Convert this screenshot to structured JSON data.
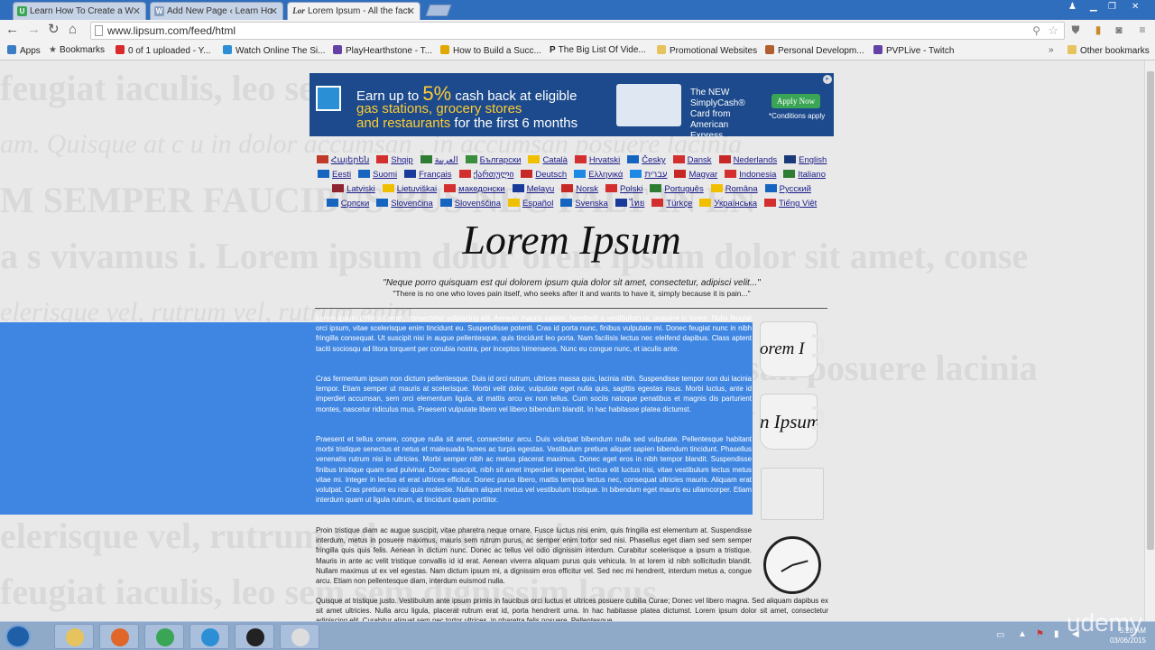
{
  "tabs": [
    {
      "title": "Learn How To Create a W",
      "favicon": "U",
      "color": "#3aa655"
    },
    {
      "title": "Add New Page ‹ Learn Ho",
      "favicon": "W",
      "color": "#8aa0bf"
    },
    {
      "title": "Lorem Ipsum - All the fact",
      "favicon": "Lor",
      "color": "#555555",
      "active": true
    }
  ],
  "toolbar": {
    "url": "www.lipsum.com/feed/html"
  },
  "bookmarks": [
    {
      "label": "Apps",
      "color": "#3c7ec6"
    },
    {
      "label": "Bookmarks",
      "color": "#555555"
    },
    {
      "label": "0 of 1 uploaded - Y...",
      "color": "#d92b2b"
    },
    {
      "label": "Watch Online The Si...",
      "color": "#2c8fd6"
    },
    {
      "label": "PlayHearthstone - T...",
      "color": "#6441a5"
    },
    {
      "label": "How to Build a Succ...",
      "color": "#e0a800"
    },
    {
      "label": "The Big List Of Vide...",
      "color": "#222222"
    },
    {
      "label": "Promotional Websites",
      "color": "#e6c35c"
    },
    {
      "label": "Personal Developm...",
      "color": "#b06030"
    },
    {
      "label": "PVPLive - Twitch",
      "color": "#6441a5"
    },
    {
      "label": "Other bookmarks",
      "color": "#e6c35c"
    }
  ],
  "ad": {
    "line1_pre": "Earn up to ",
    "line1_pct": "5%",
    "line1_post": " cash back at eligible",
    "line2": "gas stations, grocery stores",
    "line3_a": "and restaurants",
    "line3_b": " for the first 6 months",
    "card_text": "The NEW SimplyCash® Card from American Express",
    "apply": "Apply Now",
    "conditions": "*Conditions apply"
  },
  "languages": [
    {
      "name": "Հայերեն",
      "color": "#c0392b"
    },
    {
      "name": "Shqip",
      "color": "#d32f2f"
    },
    {
      "name": "‏العربية",
      "color": "#2e7d32"
    },
    {
      "name": "Български",
      "color": "#388e3c"
    },
    {
      "name": "Català",
      "color": "#f0c000"
    },
    {
      "name": "Hrvatski",
      "color": "#d32f2f"
    },
    {
      "name": "Česky",
      "color": "#1565c0"
    },
    {
      "name": "Dansk",
      "color": "#d32f2f"
    },
    {
      "name": "Nederlands",
      "color": "#c62828"
    },
    {
      "name": "English",
      "color": "#1a3a7a"
    },
    {
      "name": "Eesti",
      "color": "#1565c0"
    },
    {
      "name": "Suomi",
      "color": "#1565c0"
    },
    {
      "name": "Français",
      "color": "#1a3a9a"
    },
    {
      "name": "ქართული",
      "color": "#d32f2f"
    },
    {
      "name": "Deutsch",
      "color": "#c62828"
    },
    {
      "name": "Ελληνικά",
      "color": "#1e88e5"
    },
    {
      "name": "עברית",
      "color": "#1e88e5"
    },
    {
      "name": "Magyar",
      "color": "#c62828"
    },
    {
      "name": "Indonesia",
      "color": "#d32f2f"
    },
    {
      "name": "Italiano",
      "color": "#2e7d32"
    },
    {
      "name": "Latviski",
      "color": "#8e2430"
    },
    {
      "name": "Lietuviškai",
      "color": "#f0c000"
    },
    {
      "name": "македонски",
      "color": "#d32f2f"
    },
    {
      "name": "Melayu",
      "color": "#1a3a9a"
    },
    {
      "name": "Norsk",
      "color": "#c62828"
    },
    {
      "name": "Polski",
      "color": "#d32f2f"
    },
    {
      "name": "Português",
      "color": "#2e7d32"
    },
    {
      "name": "Româna",
      "color": "#f0c000"
    },
    {
      "name": "Pусский",
      "color": "#1565c0"
    },
    {
      "name": "Српски",
      "color": "#1565c0"
    },
    {
      "name": "Slovenčina",
      "color": "#1565c0"
    },
    {
      "name": "Slovenščina",
      "color": "#1565c0"
    },
    {
      "name": "Español",
      "color": "#f0c000"
    },
    {
      "name": "Svenska",
      "color": "#1565c0"
    },
    {
      "name": "ไทย",
      "color": "#1a3a9a"
    },
    {
      "name": "Türkçe",
      "color": "#d32f2f"
    },
    {
      "name": "Українська",
      "color": "#f0c000"
    },
    {
      "name": "Tiếng Việt",
      "color": "#d32f2f"
    }
  ],
  "main": {
    "title": "Lorem Ipsum",
    "quote_latin": "\"Neque porro quisquam est qui dolorem ipsum quia dolor sit amet, consectetur, adipisci velit...\"",
    "quote_english": "\"There is no one who loves pain itself, who seeks after it and wants to have it, simply because it is pain...\"",
    "paragraphs": [
      "Lorem ipsum dolor sit amet, consectetur adipiscing elit. Aenean mauris sapien, hendrerit a vestibulum ut, posuere in lorem. Nulla feugiat orci ipsum, vitae scelerisque enim tincidunt eu. Suspendisse potenti. Cras id porta nunc, finibus vulputate mi. Donec feugiat nunc in nibh fringilla consequat. Ut suscipit nisi in augue pellentesque, quis tincidunt leo porta. Nam facilisis lectus nec eleifend dapibus. Class aptent taciti sociosqu ad litora torquent per conubia nostra, per inceptos himenaeos. Nunc eu congue nunc, et iaculis ante.",
      "Cras fermentum ipsum non dictum pellentesque. Duis id orci rutrum, ultrices massa quis, lacinia nibh. Suspendisse tempor non dui lacinia tempor. Etiam semper ut mauris at scelerisque. Morbi velit dolor, vulputate eget nulla quis, sagittis egestas risus. Morbi luctus, ante id imperdiet accumsan, sem orci elementum ligula, at mattis arcu ex non tellus. Cum sociis natoque penatibus et magnis dis parturient montes, nascetur ridiculus mus. Praesent vulputate libero vel libero bibendum blandit. In hac habitasse platea dictumst.",
      "Praesent et tellus ornare, congue nulla sit amet, consectetur arcu. Duis volutpat bibendum nulla sed vulputate. Pellentesque habitant morbi tristique senectus et netus et malesuada fames ac turpis egestas. Vestibulum pretium aliquet sapien bibendum tincidunt. Phasellus venenatis rutrum nisi in ultricies. Morbi semper nibh ac metus placerat maximus. Donec eget eros in nibh tempor blandit. Suspendisse finibus tristique quam sed pulvinar. Donec suscipit, nibh sit amet imperdiet imperdiet, lectus elit luctus nisi, vitae vestibulum lectus metus vitae mi. Integer in lectus et erat ultrices efficitur. Donec purus libero, mattis tempus lectus nec, consequat ultricies mauris. Aliquam erat volutpat. Cras pretium eu nisi quis molestie. Nullam aliquet metus vel vestibulum tristique. In bibendum eget mauris eu ullamcorper. Etiam interdum quam ut ligula rutrum, at tincidunt quam porttitor.",
      "Proin tristique diam ac augue suscipit, vitae pharetra neque ornare. Fusce luctus nisi enim, quis fringilla est elementum at. Suspendisse interdum, metus in posuere maximus, mauris sem rutrum purus, ac semper enim tortor sed nisi. Phasellus eget diam sed sem semper fringilla quis quis felis. Aenean in dictum nunc. Donec ac tellus vel odio dignissim interdum. Curabitur scelerisque a ipsum a tristique. Mauris in ante ac velit tristique convallis id id erat. Aenean viverra aliquam purus quis vehicula. In at lorem id nibh sollicitudin blandit. Nullam maximus ut ex vel egestas. Nam dictum ipsum mi, a dignissim eros efficitur vel. Sed nec mi hendrerit, interdum metus a, congue arcu. Etiam non pellentesque diam, interdum euismod nulla.",
      "Quisque at tristique justo. Vestibulum ante ipsum primis in faucibus orci luctus et ultrices posuere cubilia Curae; Donec vel libero magna. Sed aliquam dapibus ex sit amet ultricies. Nulla arcu ligula, placerat rutrum erat id, porta hendrerit urna. In hac habitasse platea dictumst. Lorem ipsum dolor sit amet, consectetur adipiscing elit. Curabitur aliquet sem nec tortor ultrices, in pharetra felis posuere. Pellentesque"
    ],
    "selected_paragraphs": 3,
    "mug_texts": [
      "orem I",
      "n Ipsum"
    ]
  },
  "background_lines": [
    "feugiat iaculis, leo sem                                                   sem dignissim lacus",
    "am. Quisque at c u in dolor accumsan                          , in accumsan posuere lacinia",
    "M SEMPER FAUCIBUS                                                        BUS NEC PALT IN EN",
    "a s vivamus i. Lorem ipsum dolor                                              orem ipsum dolor sit amet, conse",
    "elerisque vel, rutrum                                               vel, rutrum enim",
    "am. Quisque at c u in dolor accumsan                        , in accumsan posuere lacinia",
    "M SEMPER FAUCIBUS                                                        BUS NEC PALT IN EN",
    "a s vivamus i. Lorem ipsum dolor                                              orem ipsum dolor sit amet, conse",
    "elerisque vel, rutrum                                               vel, rutrum enim",
    "feugiat iaculis, leo sem                                                   sem dignissim lacus"
  ],
  "taskbar": {
    "apps": [
      {
        "name": "explorer",
        "color": "#e6c35c"
      },
      {
        "name": "firefox",
        "color": "#e0662a"
      },
      {
        "name": "chrome",
        "color": "#3aa655"
      },
      {
        "name": "skype",
        "color": "#2c8fd6"
      },
      {
        "name": "obs",
        "color": "#222222"
      },
      {
        "name": "documents",
        "color": "#dddddd"
      }
    ],
    "time": "5:28 AM",
    "date": "03/06/2015"
  },
  "watermark": "udemy"
}
